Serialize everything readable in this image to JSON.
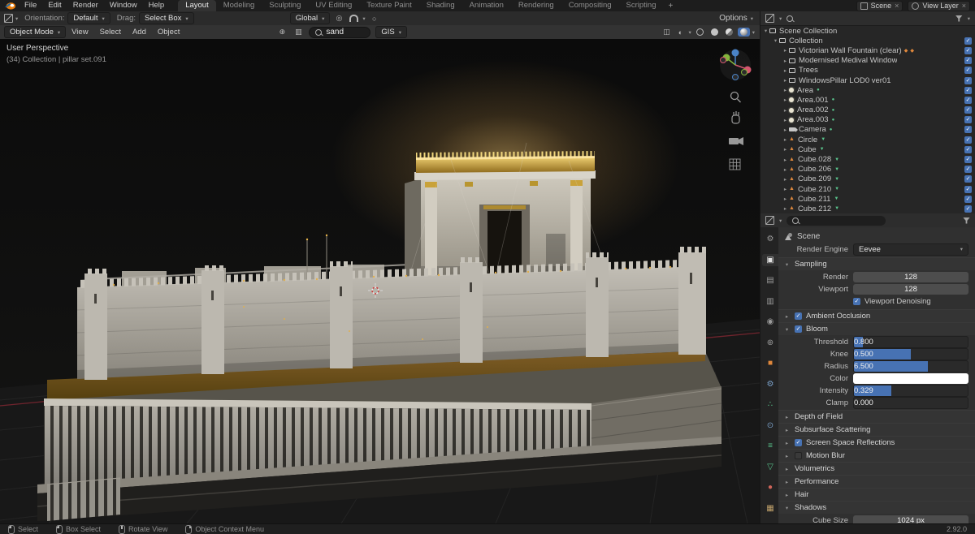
{
  "colors": {
    "accent": "#4772b3",
    "gold": "#d8a93c",
    "mesh_icon": "#e0883c",
    "data_icon": "#59c48c"
  },
  "topbar": {
    "app_menus": [
      "File",
      "Edit",
      "Render",
      "Window",
      "Help"
    ],
    "workspaces": [
      "Layout",
      "Modeling",
      "Sculpting",
      "UV Editing",
      "Texture Paint",
      "Shading",
      "Animation",
      "Rendering",
      "Compositing",
      "Scripting"
    ],
    "active_workspace": "Layout",
    "add_workspace": "+",
    "scene_selector": "Scene",
    "view_layer_selector": "View Layer"
  },
  "tool_settings": {
    "orientation_label": "Orientation:",
    "orientation_value": "Default",
    "drag_label": "Drag:",
    "drag_value": "Select Box",
    "transform_orientation": "Global",
    "options_button": "Options"
  },
  "viewport_header": {
    "mode_selector": "Object Mode",
    "menus": [
      "View",
      "Select",
      "Add",
      "Object"
    ],
    "search_value": "sand",
    "gis_button": "GIS"
  },
  "viewport": {
    "overlay_title": "User Perspective",
    "overlay_subtitle": "(34) Collection | pillar set.091"
  },
  "outliner": {
    "root_label": "Scene Collection",
    "items": [
      {
        "label": "Collection",
        "type": "collection",
        "level": 1,
        "expanded": true
      },
      {
        "label": "Victorian Wall Fountain (clear)",
        "type": "collection",
        "level": 2,
        "extras": 2
      },
      {
        "label": "Modernised Medival Window",
        "type": "collection",
        "level": 2
      },
      {
        "label": "Trees",
        "type": "collection",
        "level": 2
      },
      {
        "label": "WindowsPillar LOD0 ver01",
        "type": "collection",
        "level": 2
      },
      {
        "label": "Area",
        "type": "light",
        "level": 2
      },
      {
        "label": "Area.001",
        "type": "light",
        "level": 2
      },
      {
        "label": "Area.002",
        "type": "light",
        "level": 2
      },
      {
        "label": "Area.003",
        "type": "light",
        "level": 2
      },
      {
        "label": "Camera",
        "type": "camera",
        "level": 2
      },
      {
        "label": "Circle",
        "type": "mesh",
        "level": 2
      },
      {
        "label": "Cube",
        "type": "mesh",
        "level": 2
      },
      {
        "label": "Cube.028",
        "type": "mesh",
        "level": 2
      },
      {
        "label": "Cube.206",
        "type": "mesh",
        "level": 2
      },
      {
        "label": "Cube.209",
        "type": "mesh",
        "level": 2
      },
      {
        "label": "Cube.210",
        "type": "mesh",
        "level": 2
      },
      {
        "label": "Cube.211",
        "type": "mesh",
        "level": 2
      },
      {
        "label": "Cube.212",
        "type": "mesh",
        "level": 2
      }
    ]
  },
  "properties": {
    "breadcrumb": "Scene",
    "render_engine_label": "Render Engine",
    "render_engine_value": "Eevee",
    "sampling": {
      "title": "Sampling",
      "rows": [
        {
          "label": "Render",
          "value": "128"
        },
        {
          "label": "Viewport",
          "value": "128"
        }
      ],
      "checkbox_label": "Viewport Denoising",
      "checkbox_checked": true
    },
    "ambient_occlusion": {
      "title": "Ambient Occlusion",
      "checked": true
    },
    "bloom": {
      "title": "Bloom",
      "checked": true,
      "fields": [
        {
          "label": "Threshold",
          "value": "0.800",
          "fill": 8
        },
        {
          "label": "Knee",
          "value": "0.500",
          "fill": 50
        },
        {
          "label": "Radius",
          "value": "6.500",
          "fill": 65
        },
        {
          "label": "Color",
          "type": "color",
          "color": "#ffffff"
        },
        {
          "label": "Intensity",
          "value": "0.329",
          "fill": 33
        },
        {
          "label": "Clamp",
          "value": "0.000",
          "fill": 0
        }
      ]
    },
    "collapsed_panels": [
      {
        "title": "Depth of Field"
      },
      {
        "title": "Subsurface Scattering"
      },
      {
        "title": "Screen Space Reflections",
        "checkbox": true,
        "checked": true
      },
      {
        "title": "Motion Blur",
        "checkbox": true,
        "checked": false
      },
      {
        "title": "Volumetrics"
      },
      {
        "title": "Performance"
      },
      {
        "title": "Hair"
      },
      {
        "title": "Shadows",
        "expanded": true
      }
    ],
    "cube_size_label": "Cube Size",
    "cube_size_value": "1024 px",
    "tabs": [
      "tool",
      "render",
      "output",
      "view-layer",
      "scene",
      "world",
      "object",
      "modifiers",
      "particles",
      "physics",
      "constraints",
      "object-data",
      "material",
      "texture"
    ],
    "active_tab": "render"
  },
  "statusbar": {
    "hints": [
      "Select",
      "Box Select",
      "Rotate View",
      "Object Context Menu"
    ],
    "version": "2.92.0"
  }
}
